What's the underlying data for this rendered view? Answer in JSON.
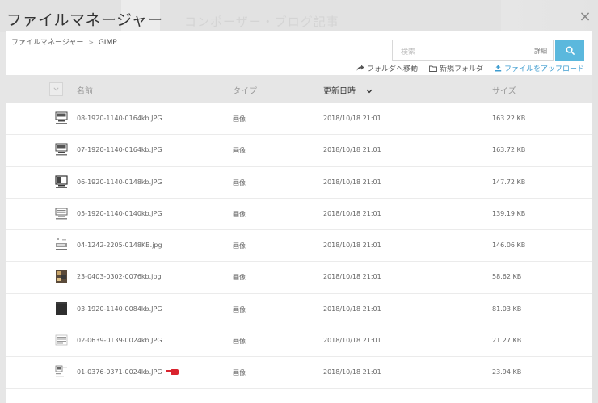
{
  "dialog": {
    "title": "ファイルマネージャー",
    "close_glyph": "×"
  },
  "background": {
    "heading": "コンポーザー・ブログ記事"
  },
  "breadcrumb": {
    "root": "ファイルマネージャー",
    "separator": ">",
    "current": "GIMP"
  },
  "search": {
    "placeholder": "検索",
    "detail_label": "詳細"
  },
  "toolbar": {
    "move_label": "フォルダへ移動",
    "new_folder_label": "新規フォルダ",
    "upload_label": "ファイルをアップロード"
  },
  "table": {
    "columns": {
      "name": "名前",
      "type": "タイプ",
      "modified": "更新日時",
      "size": "サイズ"
    },
    "rows": [
      {
        "name": "08-1920-1140-0164kb.JPG",
        "type": "画像",
        "modified": "2018/10/18 21:01",
        "size": "163.22 KB"
      },
      {
        "name": "07-1920-1140-0164kb.JPG",
        "type": "画像",
        "modified": "2018/10/18 21:01",
        "size": "163.72 KB"
      },
      {
        "name": "06-1920-1140-0148kb.JPG",
        "type": "画像",
        "modified": "2018/10/18 21:01",
        "size": "147.72 KB"
      },
      {
        "name": "05-1920-1140-0140kb.JPG",
        "type": "画像",
        "modified": "2018/10/18 21:01",
        "size": "139.19 KB"
      },
      {
        "name": "04-1242-2205-0148KB.jpg",
        "type": "画像",
        "modified": "2018/10/18 21:01",
        "size": "146.06 KB"
      },
      {
        "name": "23-0403-0302-0076kb.jpg",
        "type": "画像",
        "modified": "2018/10/18 21:01",
        "size": "58.62 KB"
      },
      {
        "name": "03-1920-1140-0084kb.JPG",
        "type": "画像",
        "modified": "2018/10/18 21:01",
        "size": "81.03 KB"
      },
      {
        "name": "02-0639-0139-0024kb.JPG",
        "type": "画像",
        "modified": "2018/10/18 21:01",
        "size": "21.27 KB"
      },
      {
        "name": "01-0376-0371-0024kb.JPG",
        "type": "画像",
        "modified": "2018/10/18 21:01",
        "size": "23.94 KB"
      }
    ]
  },
  "colors": {
    "accent": "#5bb8dd",
    "upload_link": "#3f9dd0",
    "header_bg": "#e6e6e6",
    "pointer_mark": "#d9232e"
  },
  "icons": {
    "close": "close-icon",
    "search": "search-icon",
    "move": "share-arrow-icon",
    "new_folder": "folder-icon",
    "upload": "upload-icon",
    "sort": "chevron-down-icon",
    "pointer": "pointing-hand-icon"
  }
}
